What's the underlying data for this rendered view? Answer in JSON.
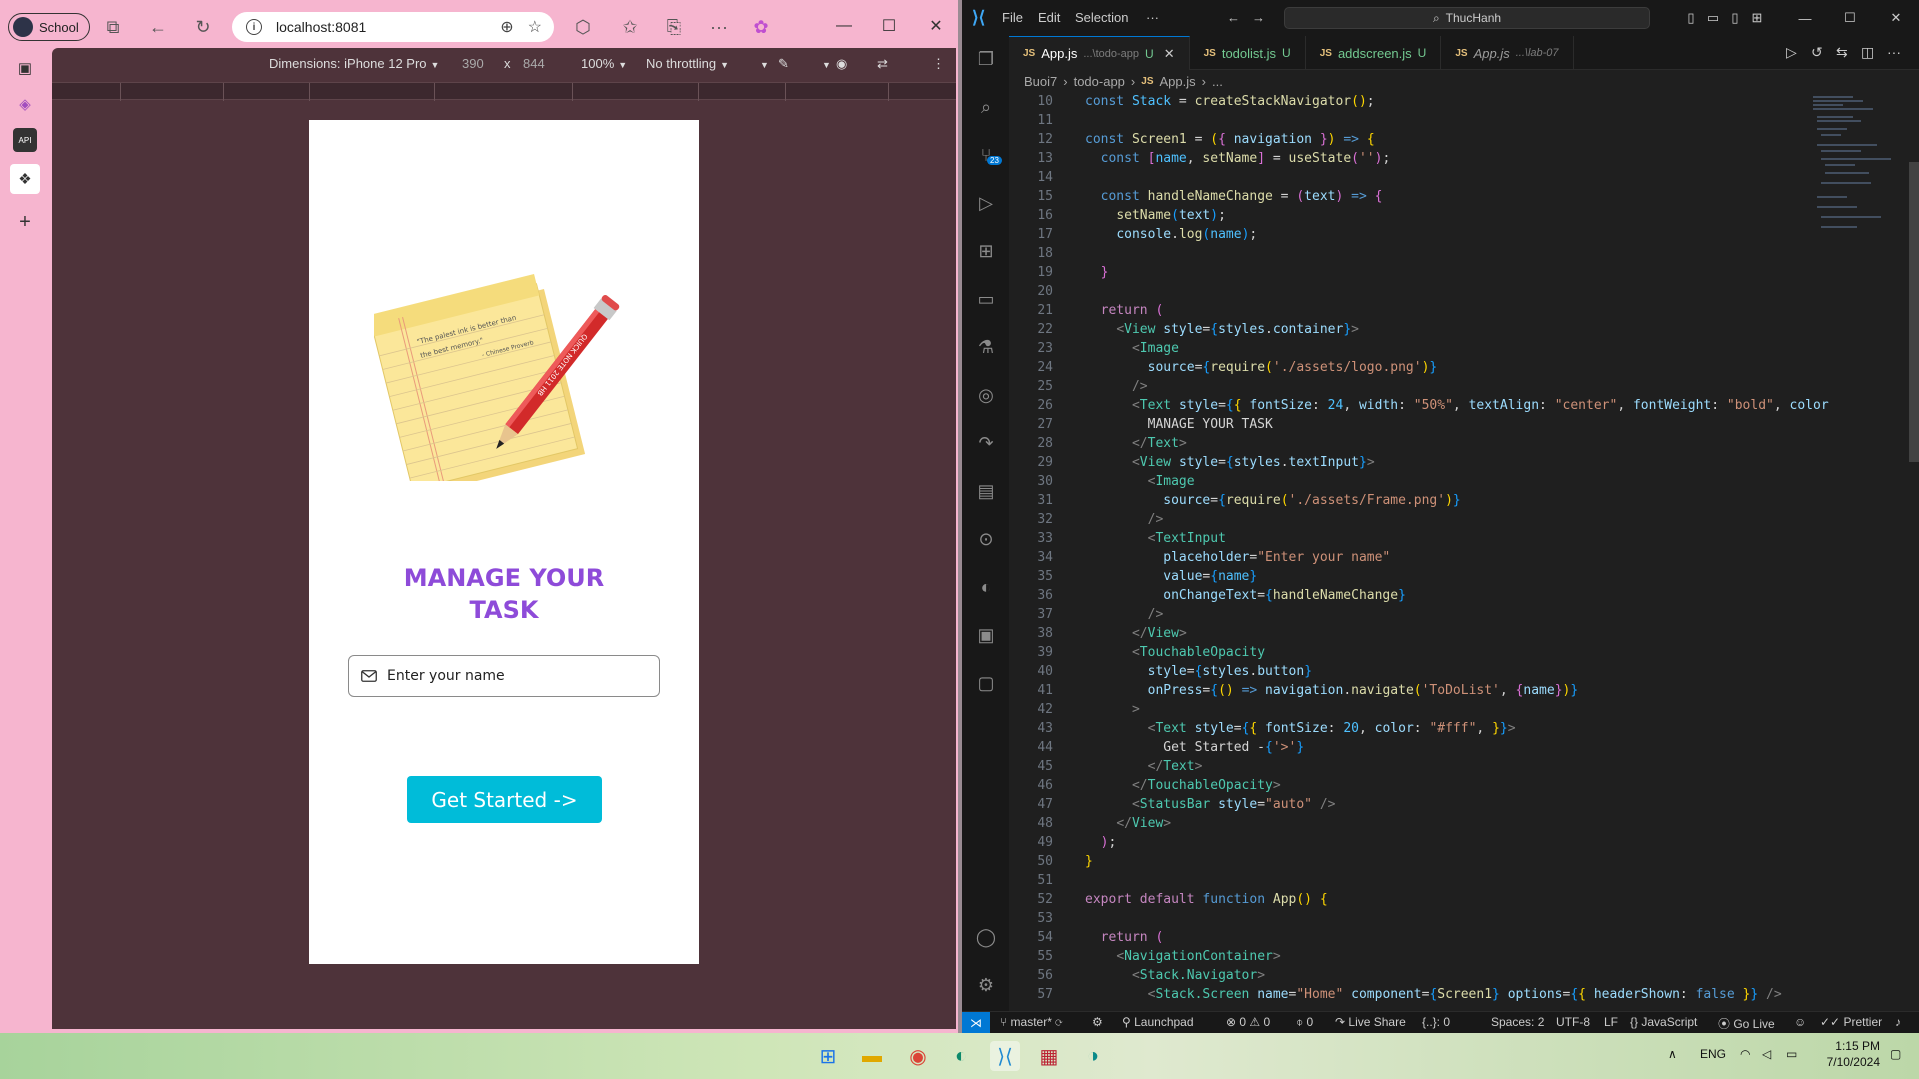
{
  "browser": {
    "profile_label": "School",
    "url": "localhost:8081",
    "devtools": {
      "dimensions": "Dimensions: iPhone 12 Pro",
      "width": "390",
      "times": "x",
      "height": "844",
      "zoom": "100%",
      "throttling": "No throttling"
    }
  },
  "app": {
    "title": "MANAGE YOUR",
    "title2": "TASK",
    "input_placeholder": "Enter your name",
    "button_label": "Get Started ->",
    "button_color": "#00bcd9",
    "title_color": "#8e4bd9",
    "logo": {
      "note_line1": "\"The palest ink is better than",
      "note_line2": "the best memory.\"",
      "note_author": "- Chinese Proverb",
      "pencil_text": "QUICK NOTE 2011 HB"
    }
  },
  "vscode": {
    "menu": [
      "File",
      "Edit",
      "Selection",
      "···"
    ],
    "search": "ThucHanh",
    "source_control_badge": "23",
    "tabs": [
      {
        "name": "App.js",
        "path": "...\\todo-app",
        "status": "U",
        "active": true
      },
      {
        "name": "todolist.js",
        "path": "",
        "status": "U",
        "active": false
      },
      {
        "name": "addscreen.js",
        "path": "",
        "status": "U",
        "active": false
      },
      {
        "name": "App.js",
        "path": "...\\lab-07",
        "status": "",
        "active": false
      }
    ],
    "breadcrumbs": [
      "Buoi7",
      "todo-app",
      "App.js",
      "..."
    ],
    "status": {
      "branch": "master*",
      "launchpad": "Launchpad",
      "errors": "0",
      "warnings": "0",
      "ports": "0",
      "live_share": "Live Share",
      "brackets": "{..}: 0",
      "spaces": "Spaces: 2",
      "encoding": "UTF-8",
      "eol": "LF",
      "language": "JavaScript",
      "go_live": "Go Live",
      "prettier": "Prettier"
    }
  },
  "taskbar": {
    "lang": "ENG",
    "time": "1:15 PM",
    "date": "7/10/2024"
  }
}
